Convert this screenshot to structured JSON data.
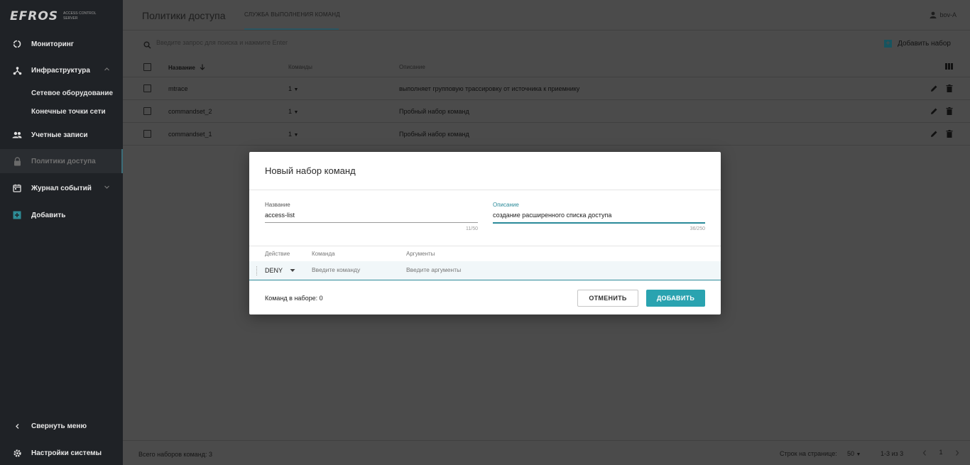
{
  "app": {
    "logo_text": "EFROS",
    "logo_subtitle": "ACCESS CONTROL SERVER"
  },
  "sidebar": {
    "items": [
      {
        "label": "Мониторинг",
        "icon": "monitoring-icon"
      },
      {
        "label": "Инфраструктура",
        "icon": "network-icon"
      },
      {
        "label": "Учетные записи",
        "icon": "users-icon"
      },
      {
        "label": "Политики доступа",
        "icon": "lock-icon"
      },
      {
        "label": "Журнал событий",
        "icon": "calendar-icon"
      },
      {
        "label": "Добавить",
        "icon": "plus-square-icon"
      }
    ],
    "subitems": [
      "Сетевое оборудование",
      "Конечные точки сети"
    ],
    "collapse_label": "Свернуть меню",
    "settings_label": "Настройки системы"
  },
  "header": {
    "title": "Политики доступа",
    "tab": "Служба выполнения команд",
    "user": "bov-A"
  },
  "search": {
    "placeholder": "Введите запрос для поиска и нажмите Enter"
  },
  "toolbar": {
    "add_label": "Добавить набор"
  },
  "table": {
    "columns": [
      "Название",
      "Команды",
      "Описание"
    ],
    "rows": [
      {
        "name": "mtrace",
        "commands": "1",
        "description": "выполняет групповую трассировку от источника к приемнику"
      },
      {
        "name": "commandset_2",
        "commands": "1",
        "description": "Пробный набор команд"
      },
      {
        "name": "commandset_1",
        "commands": "1",
        "description": "Пробный набор команд"
      }
    ]
  },
  "footer": {
    "total": "Всего наборов команд: 3",
    "rows_per_page_label": "Строк на странице:",
    "rows_per_page": "50",
    "range": "1-3 из 3",
    "page": "1"
  },
  "modal": {
    "title": "Новый набор команд",
    "name_label": "Название",
    "name_value": "access-list",
    "name_count": "11/50",
    "desc_label": "Описание",
    "desc_value": "создание расширенного списка доступа",
    "desc_count": "36/250",
    "col_action": "Действие",
    "col_command": "Команда",
    "col_args": "Аргументы",
    "action_value": "DENY",
    "command_placeholder": "Введите команду",
    "args_placeholder": "Введите аргументы",
    "count_label": "Команд в наборе: 0",
    "cancel_label": "ОТМЕНИТЬ",
    "add_label": "ДОБАВИТЬ"
  },
  "colors": {
    "accent": "#2aa3b0",
    "sidebar_bg": "#1f2226",
    "overlay_bg": "#4b4b4b"
  }
}
